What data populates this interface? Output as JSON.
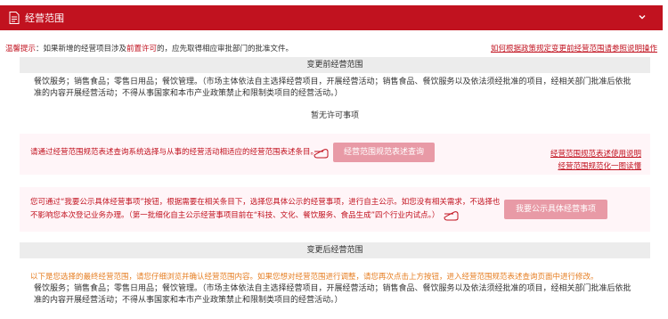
{
  "header": {
    "title": "经营范围"
  },
  "notice": {
    "prefix": "温馨提示",
    "text_1": "：如果新增的经营项目涉及",
    "highlight": "前置许可",
    "text_2": "的，应先取得相应审批部门的批准文件。",
    "link": "如何根据政策规定变更前经营范围请参照说明操作"
  },
  "before": {
    "bar_label": "变更前经营范围",
    "text": "餐饮服务；销售食品；零售日用品；餐饮管理。（市场主体依法自主选择经营项目，开展经营活动；销售食品、餐饮服务以及依法须经批准的项目，经相关部门批准后依批准的内容开展经营活动；不得从事国家和本市产业政策禁止和限制类项目的经营活动。）",
    "no_permit": "暂无许可事项"
  },
  "query_panel": {
    "text": "请通过经营范围规范表述查询系统选择与从事的经营活动相适应的经营范围表述条目。",
    "button": "经营范围规范表述查询",
    "link_1": "经营范围规范表述使用说明",
    "link_2": "经营范围规范化一图读懂"
  },
  "publicity_panel": {
    "text": "您可通过“我要公示具体经营事项”按钮，根据需要在相关条目下，选择您具体公示的经营事项，进行自主公示。如您没有相关需求，不选择也不影响您本次登记业务办理。（第一批细化自主公示经营事项目前在“科技、文化、餐饮服务、食品生成”四个行业内试点。）",
    "button": "我要公示具体经营事项"
  },
  "after": {
    "bar_label": "变更后经营范围",
    "hint": "以下是您选择的最终经营范围，请您仔细浏览并确认经营范围内容。如果您想对经营范围进行调整，请您再次点击上方按钮，进入经营范围规范表述查询页面中进行修改。",
    "text": "餐饮服务；销售食品；零售日用品；餐饮管理。（市场主体依法自主选择经营项目，开展经营活动；销售食品、餐饮服务以及依法须经批准的项目，经相关部门批准后依批准的内容开展经营活动；不得从事国家和本市产业政策禁止和限制类项目的经营活动。）"
  },
  "colors": {
    "brand_red": "#c1121f",
    "pink_bg": "#fff5f8",
    "pink_button": "#e89aa6",
    "orange": "#e67e22"
  },
  "icons": [
    "document-icon",
    "chevron-down-icon",
    "pointing-hand-icon"
  ]
}
